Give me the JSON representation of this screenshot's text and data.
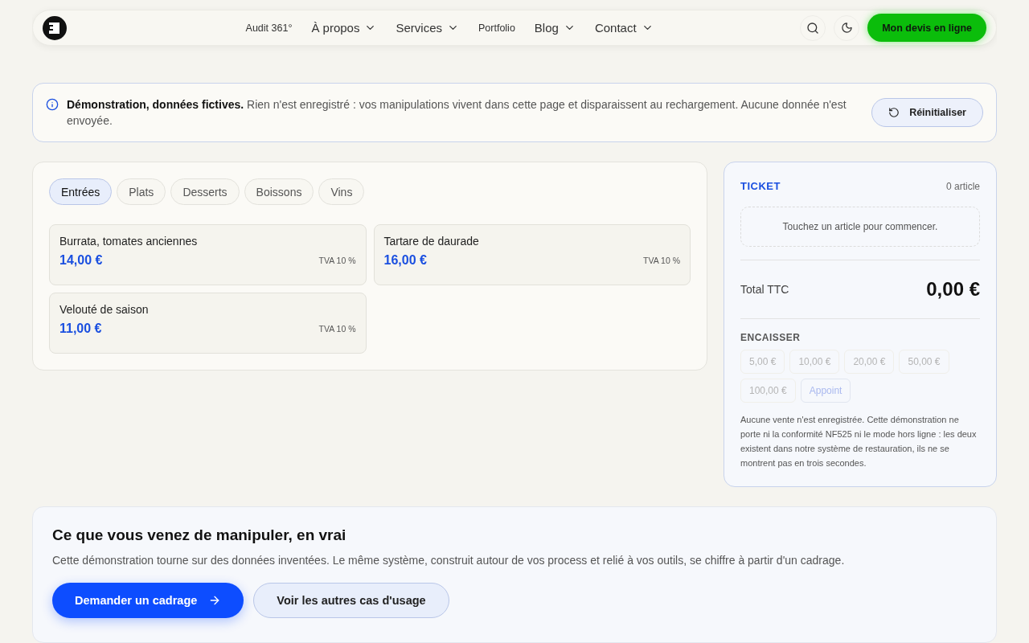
{
  "nav": {
    "links": [
      {
        "label": "Audit 361°",
        "dropdown": false
      },
      {
        "label": "À propos",
        "dropdown": true
      },
      {
        "label": "Services",
        "dropdown": true
      },
      {
        "label": "Portfolio",
        "dropdown": false
      },
      {
        "label": "Blog",
        "dropdown": true
      },
      {
        "label": "Contact",
        "dropdown": true
      }
    ],
    "cta": "Mon devis en ligne"
  },
  "notice": {
    "title": "Démonstration, données fictives.",
    "text": "Rien n'est enregistré : vos manipulations vivent dans cette page et disparaissent au rechargement. Aucune donnée n'est envoyée.",
    "button": "Réinitialiser"
  },
  "categories": [
    {
      "label": "Entrées",
      "selected": true
    },
    {
      "label": "Plats",
      "selected": false
    },
    {
      "label": "Desserts",
      "selected": false
    },
    {
      "label": "Boissons",
      "selected": false
    },
    {
      "label": "Vins",
      "selected": false
    }
  ],
  "products": [
    {
      "name": "Burrata, tomates anciennes",
      "price": "14,00 €",
      "vat": "TVA 10 %"
    },
    {
      "name": "Tartare de daurade",
      "price": "16,00 €",
      "vat": "TVA 10 %"
    },
    {
      "name": "Velouté de saison",
      "price": "11,00 €",
      "vat": "TVA 10 %"
    }
  ],
  "ticket": {
    "title": "TICKET",
    "count": "0 article",
    "empty": "Touchez un article pour commencer.",
    "total_label": "Total TTC",
    "total": "0,00 €",
    "cash_title": "ENCAISSER",
    "cash_buttons": [
      {
        "label": "5,00 €",
        "kind": "note",
        "disabled": true
      },
      {
        "label": "10,00 €",
        "kind": "note",
        "disabled": true
      },
      {
        "label": "20,00 €",
        "kind": "note",
        "disabled": true
      },
      {
        "label": "50,00 €",
        "kind": "note",
        "disabled": true
      },
      {
        "label": "100,00 €",
        "kind": "note",
        "disabled": true
      },
      {
        "label": "Appoint",
        "kind": "exact",
        "disabled": true
      }
    ],
    "note": "Aucune vente n'est enregistrée. Cette démonstration ne porte ni la conformité NF525 ni le mode hors ligne : les deux existent dans notre système de restauration, ils ne se montrent pas en trois secondes."
  },
  "cta_section": {
    "title": "Ce que vous venez de manipuler, en vrai",
    "text": "Cette démonstration tourne sur des données inventées. Le même système, construit autour de vos process et relié à vos outils, se chiffre à partir d'un cadrage.",
    "primary": "Demander un cadrage",
    "secondary": "Voir les autres cas d'usage"
  }
}
